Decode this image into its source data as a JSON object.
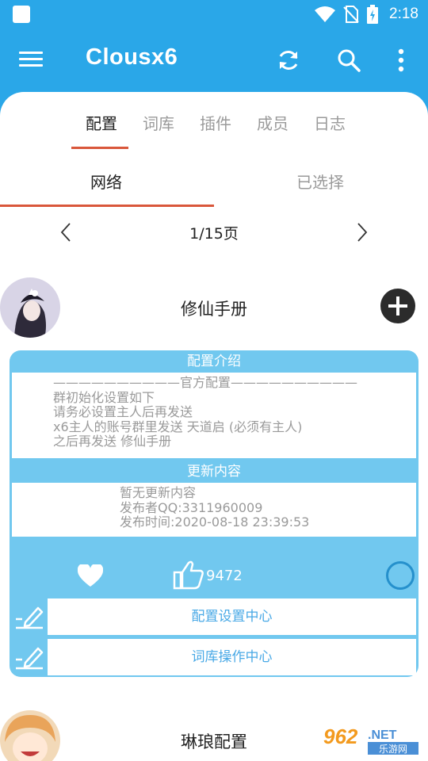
{
  "status_bar": {
    "time": "2:18"
  },
  "app_bar": {
    "title": "Clousx6"
  },
  "tabs": [
    {
      "label": "配置",
      "active": true
    },
    {
      "label": "词库",
      "active": false
    },
    {
      "label": "插件",
      "active": false
    },
    {
      "label": "成员",
      "active": false
    },
    {
      "label": "日志",
      "active": false
    }
  ],
  "subtabs": [
    {
      "label": "网络",
      "active": true
    },
    {
      "label": "已选择",
      "active": false
    }
  ],
  "pager": {
    "text": "1/15页"
  },
  "entries": [
    {
      "title": "修仙手册",
      "intro_header": "配置介绍",
      "intro_lines": [
        "——————————官方配置——————————",
        "群初始化设置如下",
        "请务必设置主人后再发送",
        "x6主人的账号群里发送 天道启 (必须有主人)",
        "之后再发送 修仙手册"
      ],
      "update_header": "更新内容",
      "update_lines": [
        "暂无更新内容",
        "发布者QQ:3311960009",
        "发布时间:2020-08-18 23:39:53"
      ],
      "likes": "9472",
      "buttons": [
        "配置设置中心",
        "词库操作中心"
      ]
    },
    {
      "title": "琳琅配置"
    }
  ],
  "watermark": {
    "brand": "962",
    "suffix": ".NET",
    "sub": "乐游网"
  },
  "colors": {
    "primary": "#2aa7e8",
    "card": "#71c8ef",
    "accent_underline": "#d9573b",
    "button_text": "#49a9e6"
  }
}
